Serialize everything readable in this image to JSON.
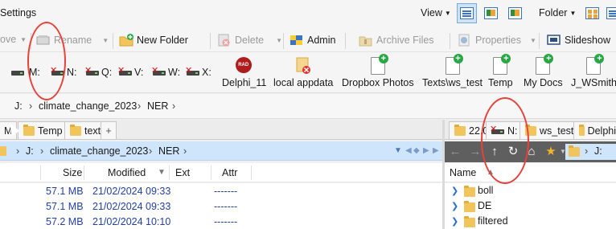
{
  "menubar": {
    "settings": "Settings",
    "view": "View",
    "folder": "Folder"
  },
  "toolbar": {
    "move": "ove",
    "rename": "Rename",
    "new_folder": "New Folder",
    "delete": "Delete",
    "admin": "Admin",
    "archive_files": "Archive Files",
    "properties": "Properties",
    "slideshow": "Slideshow"
  },
  "drives": [
    "M:",
    "N:",
    "Q:",
    "V:",
    "W:",
    "X:"
  ],
  "favorites": [
    "Delphi_11",
    "local appdata",
    "Dropbox Photos",
    "Texts\\ws_test",
    "Temp",
    "My Docs",
    "J_WSmith"
  ],
  "favorite_badge": "RAD",
  "breadcrumb": [
    "J:",
    "climate_change_2023",
    "NER"
  ],
  "left_tabs": [
    "M",
    "Temp",
    "text"
  ],
  "left_tabs_add": "+",
  "left_address": [
    "J:",
    "climate_change_2023",
    "NER"
  ],
  "left_columns": [
    "Size",
    "Modified",
    "Ext",
    "Attr"
  ],
  "left_files": [
    {
      "size": "57.1 MB",
      "date": "21/02/2024",
      "time": "09:33",
      "attr": "-------"
    },
    {
      "size": "57.1 MB",
      "date": "21/02/2024",
      "time": "09:33",
      "attr": "-------"
    },
    {
      "size": "57.2 MB",
      "date": "21/02/2024",
      "time": "10:10",
      "attr": "-------"
    }
  ],
  "right_tabs": [
    "22.0",
    "N:",
    "ws_test",
    "Delphi"
  ],
  "right_address": [
    "J:"
  ],
  "right_column": "Name",
  "right_folders": [
    "boll",
    "DE",
    "filtered"
  ],
  "colors": {
    "accent": "#3a74c4",
    "address_bg": "#cfe5fb",
    "annotation": "#e8413a",
    "folder": "#f2c55c",
    "file_text": "#2240a8"
  }
}
